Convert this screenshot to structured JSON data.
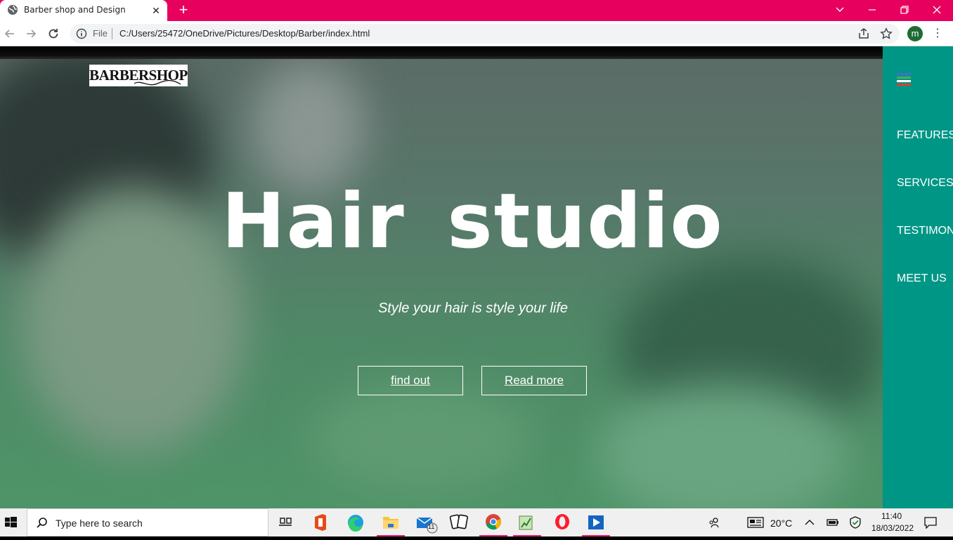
{
  "browser": {
    "tab_title": "Barber shop and Design",
    "new_tab_label": "+",
    "scheme_label": "File",
    "url": "C:/Users/25472/OneDrive/Pictures/Desktop/Barber/index.html",
    "profile_initial": "m",
    "colors": {
      "tab_strip": "#e8005f",
      "toolbar": "#ffffff"
    }
  },
  "page": {
    "logo_text": "BARBERSHOP",
    "hero_title": "Hair studio",
    "hero_subtitle": "Style your hair is style your life",
    "buttons": {
      "find_out": "find out",
      "read_more": "Read more"
    },
    "nav": {
      "features": "FEATURES",
      "services": "SERVICES",
      "testimonials": "TESTIMONIALS",
      "meet_us": "MEET US"
    },
    "colors": {
      "sidebar": "#009686",
      "hero_tint": "#4f9468"
    }
  },
  "taskbar": {
    "search_placeholder": "Type here to search",
    "mail_badge": "11",
    "temperature": "20°C",
    "time": "11:40",
    "date": "18/03/2022",
    "icons": [
      "windows-start-icon",
      "search-icon",
      "task-view-icon",
      "office-icon",
      "edge-icon",
      "file-explorer-icon",
      "mail-icon",
      "solitaire-icon",
      "chrome-icon",
      "notepad-plus-icon",
      "opera-icon",
      "media-player-icon",
      "people-icon",
      "news-weather-icon",
      "chevron-up-icon",
      "battery-icon",
      "defender-icon",
      "notification-icon"
    ]
  }
}
